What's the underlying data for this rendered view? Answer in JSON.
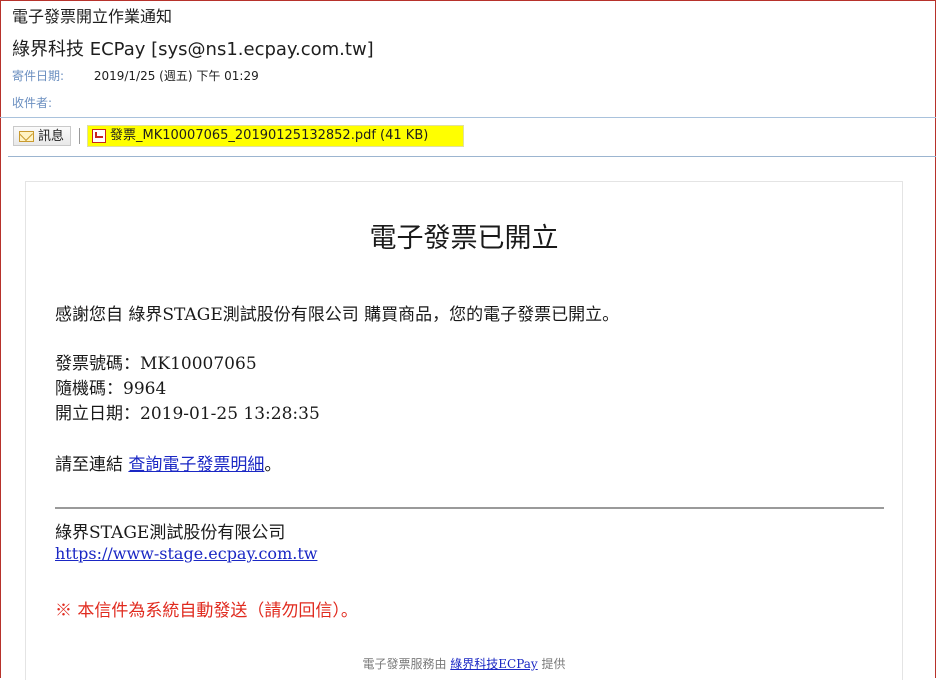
{
  "header": {
    "subject": "電子發票開立作業通知",
    "sender": "綠界科技 ECPay [sys@ns1.ecpay.com.tw]",
    "date_label": "寄件日期:",
    "date_value": "2019/1/25 (週五) 下午 01:29",
    "to_label": "收件者:"
  },
  "attachments_bar": {
    "message_label": "訊息",
    "attachment_name": "發票_MK10007065_20190125132852.pdf (41 KB)"
  },
  "email": {
    "title": "電子發票已開立",
    "intro": "感謝您自 綠界STAGE測試股份有限公司 購買商品，您的電子發票已開立。",
    "invoice_no": "發票號碼：MK10007065",
    "random_code": "隨機碼：9964",
    "issue_date": "開立日期：2019-01-25 13:28:35",
    "link_prefix": "請至連結 ",
    "link_text": "查詢電子發票明細",
    "link_suffix": "。",
    "company": "綠界STAGE測試股份有限公司",
    "company_url": "https://www-stage.ecpay.com.tw",
    "notice": "※ 本信件為系統自動發送（請勿回信）。",
    "footer_prefix": "電子發票服務由 ",
    "footer_link": "綠界科技ECPay",
    "footer_suffix": " 提供"
  },
  "colors": {
    "link": "#1a27c4",
    "warning": "#e02a1e",
    "attachment_highlight": "#ffff00",
    "meta_label": "#6b8fc0"
  },
  "icons": {
    "message": "envelope-icon",
    "attachment": "pdf-icon"
  }
}
